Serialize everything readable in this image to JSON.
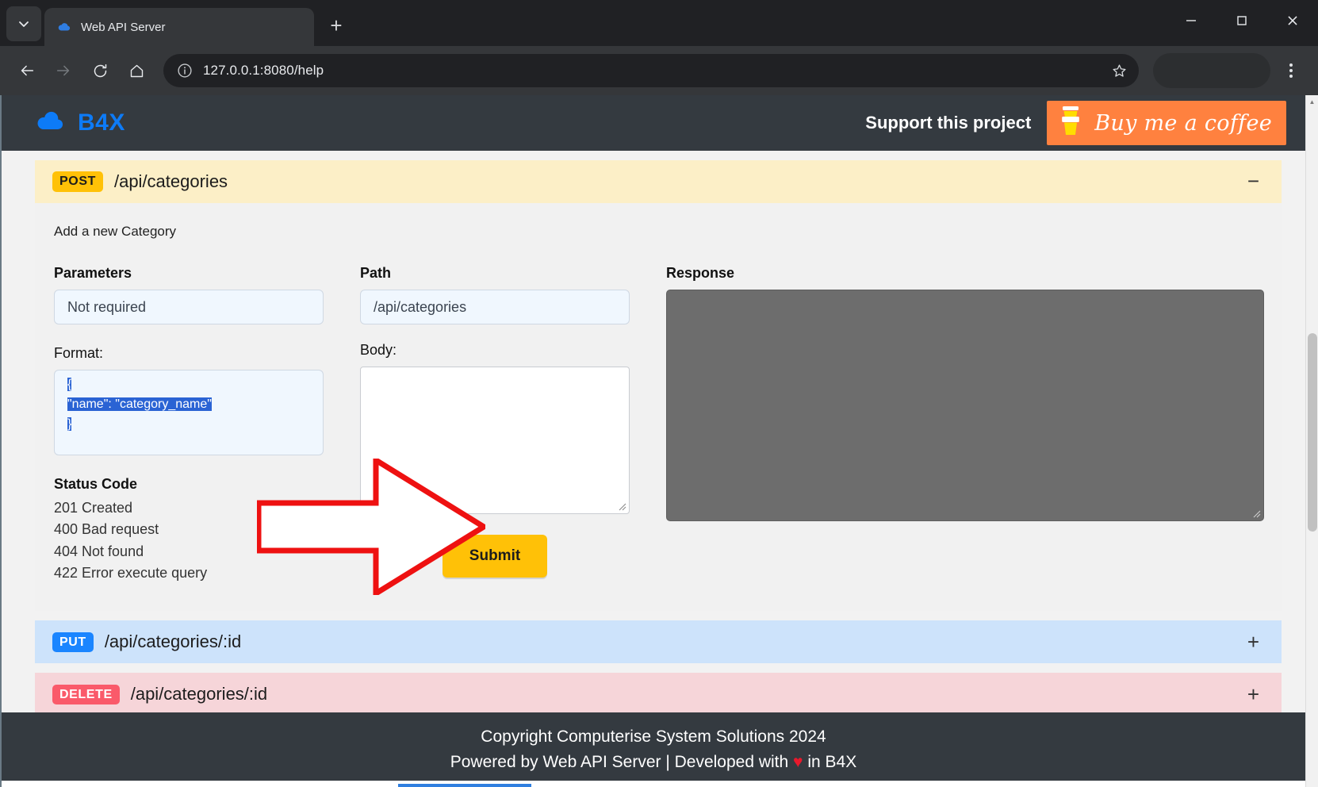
{
  "browser": {
    "tab": {
      "title": "Web API Server",
      "favicon": "cloud-icon"
    },
    "url": "127.0.0.1:8080/help",
    "new_tab_label": "+",
    "close_label": "×",
    "window_controls": {
      "minimize": "—",
      "maximize": "☐",
      "close": "×"
    }
  },
  "site": {
    "brand": "B4X",
    "support_text": "Support this project",
    "coffee_label": "Buy me a coffee"
  },
  "endpoints": [
    {
      "method": "POST",
      "path": "/api/categories",
      "toggle": "−",
      "expanded": true,
      "description": "Add a new Category",
      "parameters_label": "Parameters",
      "parameters_value": "Not required",
      "format_label": "Format:",
      "format_lines": [
        "{",
        "\"name\": \"category_name\"",
        "}"
      ],
      "status_title": "Status Code",
      "status_codes": [
        "201 Created",
        "400 Bad request",
        "404 Not found",
        "422 Error execute query"
      ],
      "path_label": "Path",
      "path_value": "/api/categories",
      "body_label": "Body:",
      "body_value": "",
      "submit_label": "Submit",
      "response_label": "Response",
      "response_value": ""
    },
    {
      "method": "PUT",
      "path": "/api/categories/:id",
      "toggle": "+",
      "expanded": false
    },
    {
      "method": "DELETE",
      "path": "/api/categories/:id",
      "toggle": "+",
      "expanded": false
    }
  ],
  "footer": {
    "line1": "Copyright Computerise System Solutions 2024",
    "line2_before": "Powered by Web API Server | Developed with ",
    "line2_heart": "♥",
    "line2_after": " in B4X"
  },
  "colors": {
    "brand_blue": "#0d7bf7",
    "coffee_orange": "#ff813f",
    "post_amber": "#ffc107",
    "put_blue": "#1a85ff",
    "delete_red": "#fa5a6a",
    "annotation_red": "#ee1111",
    "selection_blue": "#2a63d4"
  }
}
